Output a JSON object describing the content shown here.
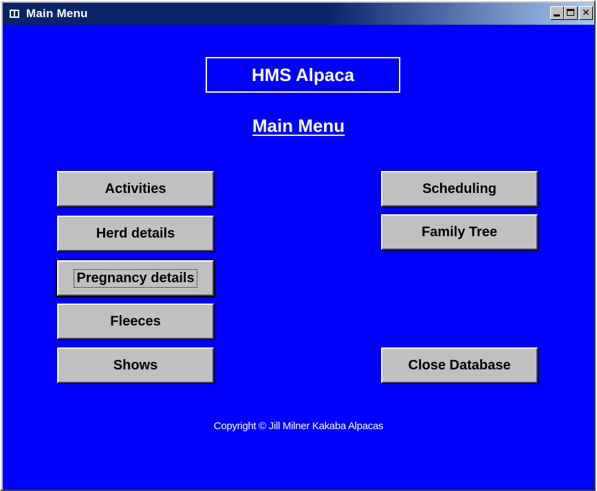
{
  "window": {
    "title": "Main Menu",
    "controls": {
      "minimize": "minimize",
      "maximize": "maximize",
      "close": "✕"
    }
  },
  "app": {
    "name": "HMS Alpaca",
    "heading": "Main Menu"
  },
  "buttons": {
    "activities": "Activities",
    "herd_details": "Herd details",
    "pregnancy_details": "Pregnancy details",
    "fleeces": "Fleeces",
    "shows": "Shows",
    "scheduling": "Scheduling",
    "family_tree": "Family Tree",
    "close_database": "Close Database"
  },
  "footer": {
    "copyright": "Copyright © Jill Milner Kakaba Alpacas"
  },
  "colors": {
    "background": "#0000ff",
    "button_face": "#c0c0c0",
    "titlebar": "#0a246a"
  }
}
